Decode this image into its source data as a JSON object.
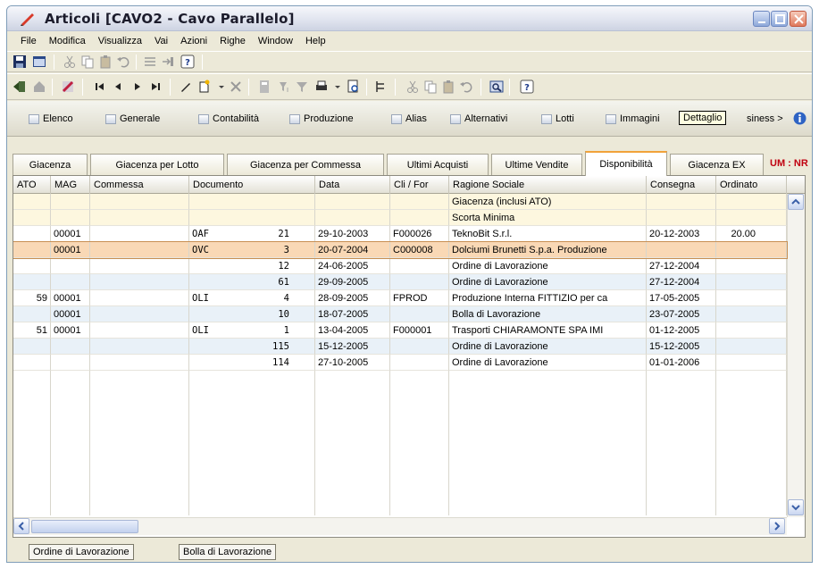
{
  "window": {
    "title": "Articoli [CAVO2 - Cavo Parallelo]"
  },
  "menu": [
    "File",
    "Modifica",
    "Visualizza",
    "Vai",
    "Azioni",
    "Righe",
    "Window",
    "Help"
  ],
  "nav": {
    "items": [
      "Elenco",
      "Generale",
      "Contabilità",
      "Produzione",
      "Alias",
      "Alternativi",
      "Lotti",
      "Immagini"
    ],
    "overflow_label": "siness >",
    "tooltip": "Dettaglio"
  },
  "tabs": {
    "items": [
      "Giacenza",
      "Giacenza per Lotto",
      "Giacenza per Commessa",
      "Ultimi Acquisti",
      "Ultime Vendite",
      "Disponibilità",
      "Giacenza EX"
    ],
    "active": "Disponibilità",
    "um_label": "UM : NR"
  },
  "grid": {
    "columns": [
      "ATO",
      "MAG",
      "Commessa",
      "Documento",
      "Data",
      "Cli / For",
      "Ragione Sociale",
      "Consegna",
      "Ordinato"
    ],
    "rows": [
      {
        "ato": "",
        "mag": "",
        "commessa": "",
        "doc_type": "",
        "doc_num": "",
        "data": "",
        "clifor": "",
        "ragione": "Giacenza (inclusi ATO)",
        "consegna": "",
        "ordinato": ""
      },
      {
        "ato": "",
        "mag": "",
        "commessa": "",
        "doc_type": "",
        "doc_num": "",
        "data": "",
        "clifor": "",
        "ragione": "Scorta Minima",
        "consegna": "",
        "ordinato": ""
      },
      {
        "ato": "",
        "mag": "00001",
        "commessa": "",
        "doc_type": "OAF",
        "doc_num": "21",
        "data": "29-10-2003",
        "clifor": "F000026",
        "ragione": "TeknoBit S.r.l.",
        "consegna": "20-12-2003",
        "ordinato": "20.00"
      },
      {
        "ato": "",
        "mag": "00001",
        "commessa": "",
        "doc_type": "OVC",
        "doc_num": "3",
        "data": "20-07-2004",
        "clifor": "C000008",
        "ragione": "Dolciumi Brunetti S.p.a. Produzione",
        "consegna": "",
        "ordinato": ""
      },
      {
        "ato": "",
        "mag": "",
        "commessa": "",
        "doc_type": "",
        "doc_num": "12",
        "data": "24-06-2005",
        "clifor": "",
        "ragione": "Ordine di Lavorazione",
        "consegna": "27-12-2004",
        "ordinato": ""
      },
      {
        "ato": "",
        "mag": "",
        "commessa": "",
        "doc_type": "",
        "doc_num": "61",
        "data": "29-09-2005",
        "clifor": "",
        "ragione": "Ordine di Lavorazione",
        "consegna": "27-12-2004",
        "ordinato": ""
      },
      {
        "ato": "59",
        "mag": "00001",
        "commessa": "",
        "doc_type": "OLI",
        "doc_num": "4",
        "data": "28-09-2005",
        "clifor": "FPROD",
        "ragione": "Produzione Interna FITTIZIO per ca",
        "consegna": "17-05-2005",
        "ordinato": ""
      },
      {
        "ato": "",
        "mag": "00001",
        "commessa": "",
        "doc_type": "",
        "doc_num": "10",
        "data": "18-07-2005",
        "clifor": "",
        "ragione": "Bolla di Lavorazione",
        "consegna": "23-07-2005",
        "ordinato": ""
      },
      {
        "ato": "51",
        "mag": "00001",
        "commessa": "",
        "doc_type": "OLI",
        "doc_num": "1",
        "data": "13-04-2005",
        "clifor": "F000001",
        "ragione": "Trasporti CHIARAMONTE SPA IMI",
        "consegna": "01-12-2005",
        "ordinato": ""
      },
      {
        "ato": "",
        "mag": "",
        "commessa": "",
        "doc_type": "",
        "doc_num": "115",
        "data": "15-12-2005",
        "clifor": "",
        "ragione": "Ordine di Lavorazione",
        "consegna": "15-12-2005",
        "ordinato": ""
      },
      {
        "ato": "",
        "mag": "",
        "commessa": "",
        "doc_type": "",
        "doc_num": "114",
        "data": "27-10-2005",
        "clifor": "",
        "ragione": "Ordine di Lavorazione",
        "consegna": "01-01-2006",
        "ordinato": ""
      }
    ],
    "selected_row": 3
  },
  "status": {
    "buttons": [
      "Ordine di Lavorazione",
      "Bolla di Lavorazione"
    ]
  },
  "colors": {
    "selected_row": "#f9d8b5",
    "highlight_row": "#fdf7df",
    "alt_row": "#e9f1f8",
    "tab_accent": "#f1a33a",
    "um_label": "#c00010"
  }
}
